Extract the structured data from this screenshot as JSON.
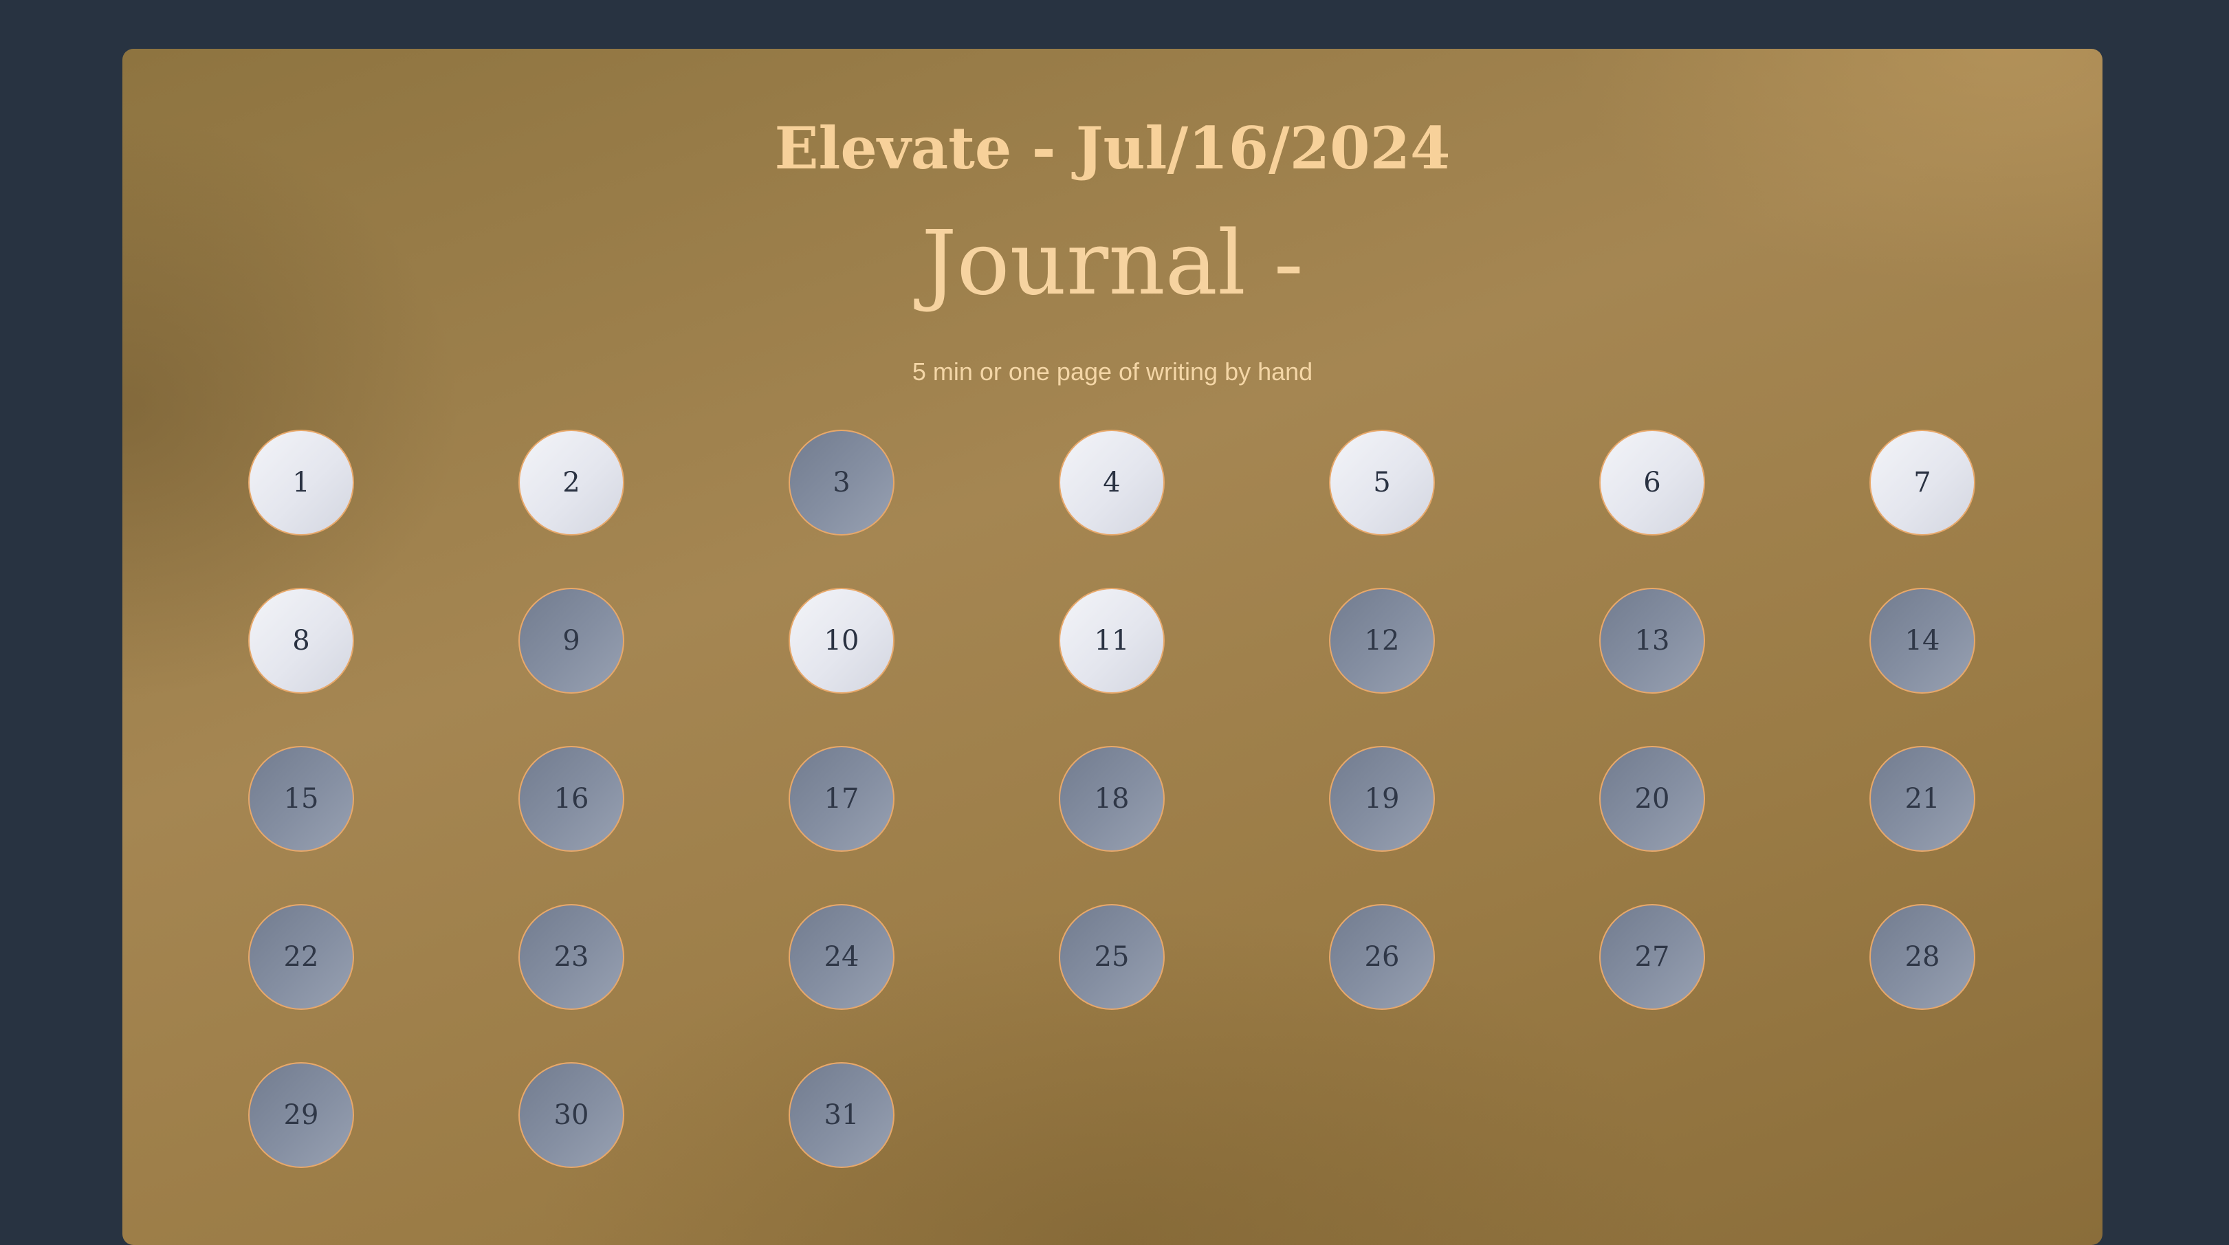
{
  "header": {
    "title": "Elevate - Jul/16/2024",
    "subtitle": "Journal -",
    "caption": "5 min or one page of writing by hand"
  },
  "colors": {
    "background": "#283341",
    "title": "#f7d19a",
    "day_done": "#eceef4",
    "day_todo": "#828ca0",
    "day_border": "#e8a86a"
  },
  "days": [
    {
      "label": "1",
      "done": true
    },
    {
      "label": "2",
      "done": true
    },
    {
      "label": "3",
      "done": false
    },
    {
      "label": "4",
      "done": true
    },
    {
      "label": "5",
      "done": true
    },
    {
      "label": "6",
      "done": true
    },
    {
      "label": "7",
      "done": true
    },
    {
      "label": "8",
      "done": true
    },
    {
      "label": "9",
      "done": false
    },
    {
      "label": "10",
      "done": true
    },
    {
      "label": "11",
      "done": true
    },
    {
      "label": "12",
      "done": false
    },
    {
      "label": "13",
      "done": false
    },
    {
      "label": "14",
      "done": false
    },
    {
      "label": "15",
      "done": false
    },
    {
      "label": "16",
      "done": false
    },
    {
      "label": "17",
      "done": false
    },
    {
      "label": "18",
      "done": false
    },
    {
      "label": "19",
      "done": false
    },
    {
      "label": "20",
      "done": false
    },
    {
      "label": "21",
      "done": false
    },
    {
      "label": "22",
      "done": false
    },
    {
      "label": "23",
      "done": false
    },
    {
      "label": "24",
      "done": false
    },
    {
      "label": "25",
      "done": false
    },
    {
      "label": "26",
      "done": false
    },
    {
      "label": "27",
      "done": false
    },
    {
      "label": "28",
      "done": false
    },
    {
      "label": "29",
      "done": false
    },
    {
      "label": "30",
      "done": false
    },
    {
      "label": "31",
      "done": false
    }
  ]
}
